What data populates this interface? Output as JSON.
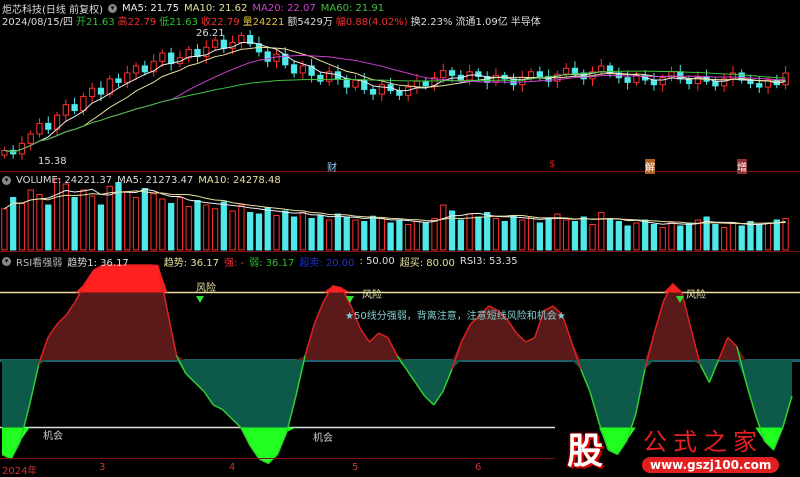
{
  "header": {
    "title": "炬芯科技(日线 前复权)",
    "ma5": "MA5: 21.75",
    "ma10": "MA10: 21.62",
    "ma20": "MA20: 22.07",
    "ma60": "MA60: 21.91",
    "date": "2024/08/15/四",
    "open": "开21.63",
    "high": "高22.79",
    "low": "低21.63",
    "close": "收22.79",
    "vol": "量24221",
    "amount": "额5429万",
    "change": "幅0.88(4.02%)",
    "turnover": "换2.23%",
    "float": "流通1.09亿",
    "sector": "半导体"
  },
  "price": {
    "max_label": "26.21",
    "min_label": "15.38",
    "markers": [
      "财",
      "$",
      "解",
      "增"
    ],
    "closes": [
      16.2,
      15.9,
      16.8,
      17.6,
      18.5,
      18.0,
      19.2,
      20.1,
      19.6,
      20.8,
      21.5,
      21.0,
      22.3,
      22.0,
      22.8,
      23.4,
      22.9,
      23.8,
      24.5,
      23.6,
      24.1,
      24.8,
      24.2,
      25.0,
      25.6,
      24.9,
      25.4,
      26.0,
      25.3,
      24.6,
      23.8,
      24.4,
      23.5,
      22.8,
      23.4,
      22.6,
      22.1,
      22.9,
      22.3,
      21.6,
      22.2,
      21.4,
      21.0,
      21.8,
      21.3,
      20.9,
      21.6,
      22.1,
      21.7,
      22.4,
      23.0,
      22.6,
      22.2,
      22.9,
      22.5,
      22.0,
      22.6,
      22.3,
      21.8,
      22.4,
      22.9,
      22.5,
      22.1,
      22.7,
      23.2,
      22.8,
      22.3,
      22.9,
      23.4,
      22.8,
      22.4,
      22.0,
      22.6,
      22.2,
      21.8,
      22.4,
      22.9,
      22.3,
      21.9,
      22.5,
      22.1,
      21.7,
      22.3,
      22.8,
      22.2,
      21.9,
      21.6,
      22.2,
      21.8,
      22.79
    ]
  },
  "volume": {
    "label": "VOLUME: 24221.37",
    "ma5": "MA5: 21273.47",
    "ma10": "MA10: 24278.48",
    "values": [
      55,
      70,
      62,
      80,
      74,
      60,
      95,
      88,
      70,
      80,
      72,
      60,
      85,
      90,
      78,
      70,
      82,
      75,
      68,
      62,
      70,
      58,
      66,
      60,
      55,
      64,
      52,
      60,
      50,
      48,
      56,
      46,
      52,
      44,
      50,
      42,
      46,
      40,
      48,
      44,
      40,
      38,
      45,
      42,
      36,
      40,
      34,
      38,
      36,
      42,
      60,
      52,
      40,
      48,
      44,
      50,
      42,
      38,
      46,
      40,
      44,
      36,
      42,
      48,
      40,
      38,
      44,
      34,
      50,
      42,
      38,
      32,
      36,
      40,
      34,
      30,
      38,
      32,
      36,
      40,
      44,
      34,
      30,
      36,
      32,
      38,
      34,
      36,
      40,
      42
    ]
  },
  "rsi": {
    "label": "RSI看强弱",
    "trend1": "趋势1: 36.17",
    "trend": "趋势: 36.17",
    "strong": "强: -",
    "weak": "弱: 36.17",
    "oversold": "超卖: 20.00",
    "mid": ": 50.00",
    "overbought": "超买: 80.00",
    "rsi3": "RSI3: 53.35",
    "risk_label": "风险",
    "chance_label": "机会",
    "note": "★50线分强弱，背离注意，注意短线风险和机会★",
    "values": [
      8,
      6,
      14,
      30,
      48,
      60,
      66,
      70,
      76,
      84,
      90,
      94,
      96,
      97,
      97,
      96,
      95,
      92,
      72,
      52,
      44,
      40,
      36,
      30,
      28,
      24,
      20,
      12,
      6,
      4,
      8,
      18,
      34,
      52,
      66,
      76,
      83,
      82,
      74,
      64,
      58,
      62,
      60,
      52,
      46,
      40,
      34,
      30,
      36,
      46,
      58,
      66,
      70,
      74,
      72,
      68,
      62,
      58,
      60,
      72,
      74,
      70,
      58,
      46,
      36,
      22,
      10,
      8,
      14,
      26,
      46,
      62,
      76,
      84,
      80,
      64,
      48,
      40,
      50,
      60,
      56,
      40,
      26,
      14,
      10,
      20,
      34
    ]
  },
  "axis": {
    "labels": [
      "2024年",
      "3",
      "4",
      "5",
      "6"
    ]
  },
  "watermark": {
    "char": "股",
    "name": "公式之家",
    "url": "www.gszj100.com"
  }
}
